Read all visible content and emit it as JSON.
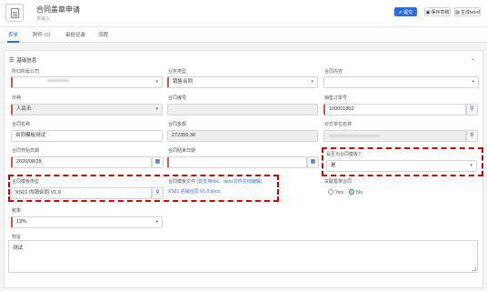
{
  "header": {
    "title": "合同盖章申请",
    "subtitle": "未输入",
    "buttons": {
      "submit": "提交",
      "save_draft": "保存草稿",
      "generate_word": "生成word"
    },
    "submit_icon": "check-icon",
    "accent_color": "#2a6fdb"
  },
  "tabs": [
    {
      "label": "表单",
      "active": true
    },
    {
      "label": "附件",
      "badge": "(0)"
    },
    {
      "label": "审批记录"
    },
    {
      "label": "流程"
    }
  ],
  "section": {
    "title": "基础信息"
  },
  "form": {
    "company": {
      "label": "所归所属公司",
      "value": ""
    },
    "business_type": {
      "label": "业务类型",
      "value": "销售合同"
    },
    "contract_content": {
      "label": "合同内容",
      "value": ""
    },
    "currency": {
      "label": "币种",
      "value": "人民币"
    },
    "contract_no": {
      "label": "合同编号",
      "value": ""
    },
    "sales_order_no": {
      "label": "销售订单号",
      "value": "100001802"
    },
    "contract_name": {
      "label": "合同名称",
      "value": "合同模板测试"
    },
    "contract_amount": {
      "label": "合同金额",
      "value": "272359.38"
    },
    "counterparty": {
      "label": "对方单位名称",
      "value": ""
    },
    "start_date": {
      "label": "合同开始日期",
      "value": "2020/08/28"
    },
    "end_date": {
      "label": "合同结束日期",
      "value": ""
    },
    "is_template": {
      "label": "是否为合同模板?",
      "value": "是"
    },
    "template_type": {
      "label": "合同模板类型",
      "value": "XS01 内销合同 V1.0"
    },
    "template_file": {
      "label": "合同模板文件",
      "note": "(仅支持doc、docx文件在线编辑)",
      "value": "XS01 内销合同 V1.0.docx"
    },
    "related_contract": {
      "label": "关联框架合同",
      "options": [
        "Yes",
        "No"
      ],
      "selected": "No"
    },
    "tax_rate": {
      "label": "税率",
      "value": "13%"
    },
    "remark": {
      "label": "附言",
      "value": "测试"
    }
  },
  "highlight_color": "#d00000"
}
